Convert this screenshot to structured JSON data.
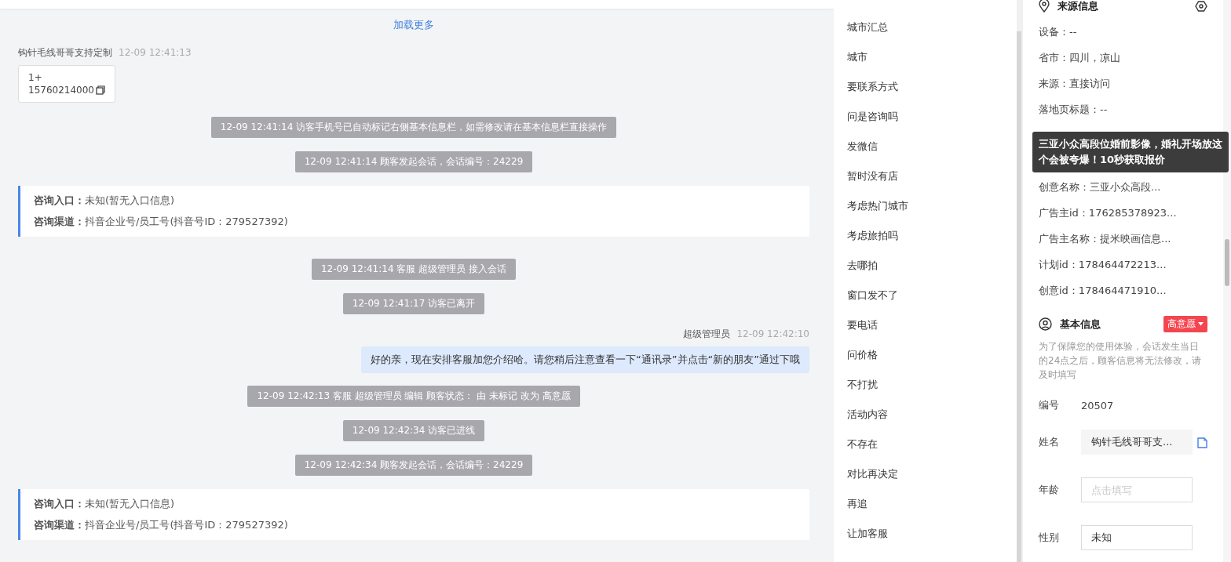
{
  "chat": {
    "load_more": "加载更多",
    "messages": [
      {
        "kind": "visitor",
        "name": "钩针毛线哥哥支持定制",
        "time": "12-09 12:41:13",
        "lines": [
          "1+",
          "15760214000"
        ]
      },
      {
        "kind": "system",
        "text": "12-09 12:41:14 访客手机号已自动标记右侧基本信息栏，如需修改请在基本信息栏直接操作"
      },
      {
        "kind": "system",
        "text": "12-09 12:41:14 顾客发起会话，会话编号：24229"
      },
      {
        "kind": "info",
        "rows": [
          {
            "label": "咨询入口：",
            "value": "未知(暂无入口信息)"
          },
          {
            "label": "咨询渠道：",
            "value": "抖音企业号/员工号(抖音号ID：279527392)"
          }
        ]
      },
      {
        "kind": "system",
        "text": "12-09 12:41:14 客服 超级管理员 接入会话"
      },
      {
        "kind": "system",
        "text": "12-09 12:41:17 访客已离开"
      },
      {
        "kind": "agent",
        "name": "超级管理员",
        "time": "12-09 12:42:10",
        "text": "好的亲，现在安排客服加您介绍哈。请您稍后注意查看一下“通讯录”并点击“新的朋友”通过下哦"
      },
      {
        "kind": "system",
        "text": "12-09 12:42:13 客服 超级管理员 编辑 顾客状态： 由 未标记 改为 高意愿"
      },
      {
        "kind": "system",
        "text": "12-09 12:42:34 访客已进线"
      },
      {
        "kind": "system",
        "text": "12-09 12:42:34 顾客发起会话，会话编号：24229"
      },
      {
        "kind": "info",
        "rows": [
          {
            "label": "咨询入口：",
            "value": "未知(暂无入口信息)"
          },
          {
            "label": "咨询渠道：",
            "value": "抖音企业号/员工号(抖音号ID：279527392)"
          }
        ]
      }
    ]
  },
  "quick_replies": [
    "城市汇总",
    "城市",
    "要联系方式",
    "问是咨询吗",
    "发微信",
    "暂时没有店",
    "考虑热门城市",
    "考虑旅拍吗",
    "去哪拍",
    "窗口发不了",
    "要电话",
    "问价格",
    "不打扰",
    "活动内容",
    "不存在",
    "对比再决定",
    "再追",
    "让加客服"
  ],
  "source_info": {
    "title": "来源信息",
    "rows": [
      {
        "kind": "row",
        "text": "设备：--"
      },
      {
        "kind": "row",
        "text": "省市：四川，凉山"
      },
      {
        "kind": "row",
        "text": "来源：直接访问"
      },
      {
        "kind": "row",
        "text": "落地页标题：--"
      },
      {
        "kind": "hidden"
      },
      {
        "kind": "hidden"
      },
      {
        "kind": "row",
        "text": "创意名称：三亚小众高段..."
      },
      {
        "kind": "row",
        "text": "广告主id：176285378923..."
      },
      {
        "kind": "row",
        "text": "广告主名称：提米映画信息..."
      },
      {
        "kind": "row",
        "text": "计划id：178464472213..."
      },
      {
        "kind": "row",
        "text": "创意id：178464471910..."
      }
    ],
    "tooltip": "三亚小众高段位婚前影像，婚礼开场放这个会被夸爆！10秒获取报价"
  },
  "basic_info": {
    "title": "基本信息",
    "intent_tag": "高意愿",
    "note": "为了保障您的使用体验，会话发生当日的24点之后，顾客信息将无法修改，请及时填写",
    "fields": [
      {
        "kind": "text",
        "label": "编号",
        "value": "20507"
      },
      {
        "kind": "copy",
        "label": "姓名",
        "value": "钩针毛线哥哥支..."
      },
      {
        "kind": "input",
        "label": "年龄",
        "placeholder": "点击填写"
      },
      {
        "kind": "select",
        "label": "性别",
        "value": "未知"
      }
    ]
  }
}
